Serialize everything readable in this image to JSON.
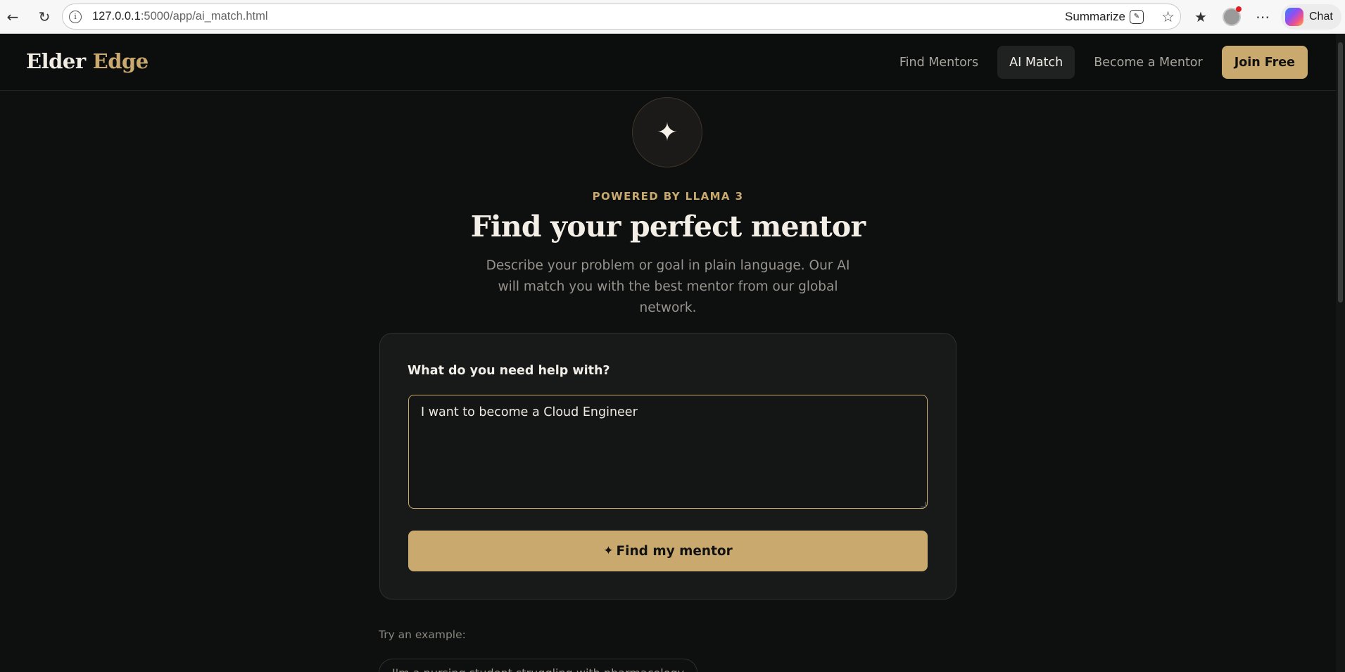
{
  "browser": {
    "url_host": "127.0.0.1",
    "url_rest": ":5000/app/ai_match.html",
    "summarize_label": "Summarize",
    "chat_label": "Chat"
  },
  "header": {
    "logo_primary": "Elder",
    "logo_accent": "Edge",
    "nav": [
      "Find Mentors",
      "AI Match",
      "Become a Mentor"
    ],
    "cta_label": "Join Free"
  },
  "hero": {
    "icon": "sparkle-icon",
    "eyebrow": "POWERED BY LLAMA 3",
    "title": "Find your perfect mentor",
    "subtitle": "Describe your problem or goal in plain language. Our AI will match you with the best mentor from our global network."
  },
  "form": {
    "label": "What do you need help with?",
    "value": "I want to become a Cloud Engineer",
    "submit_label": "Find my mentor"
  },
  "examples": {
    "label": "Try an example:",
    "items": [
      "I'm a nursing student struggling with pharmacology"
    ]
  },
  "colors": {
    "accent": "#c9a96e",
    "background": "#0e0f0f",
    "card": "#181919"
  }
}
